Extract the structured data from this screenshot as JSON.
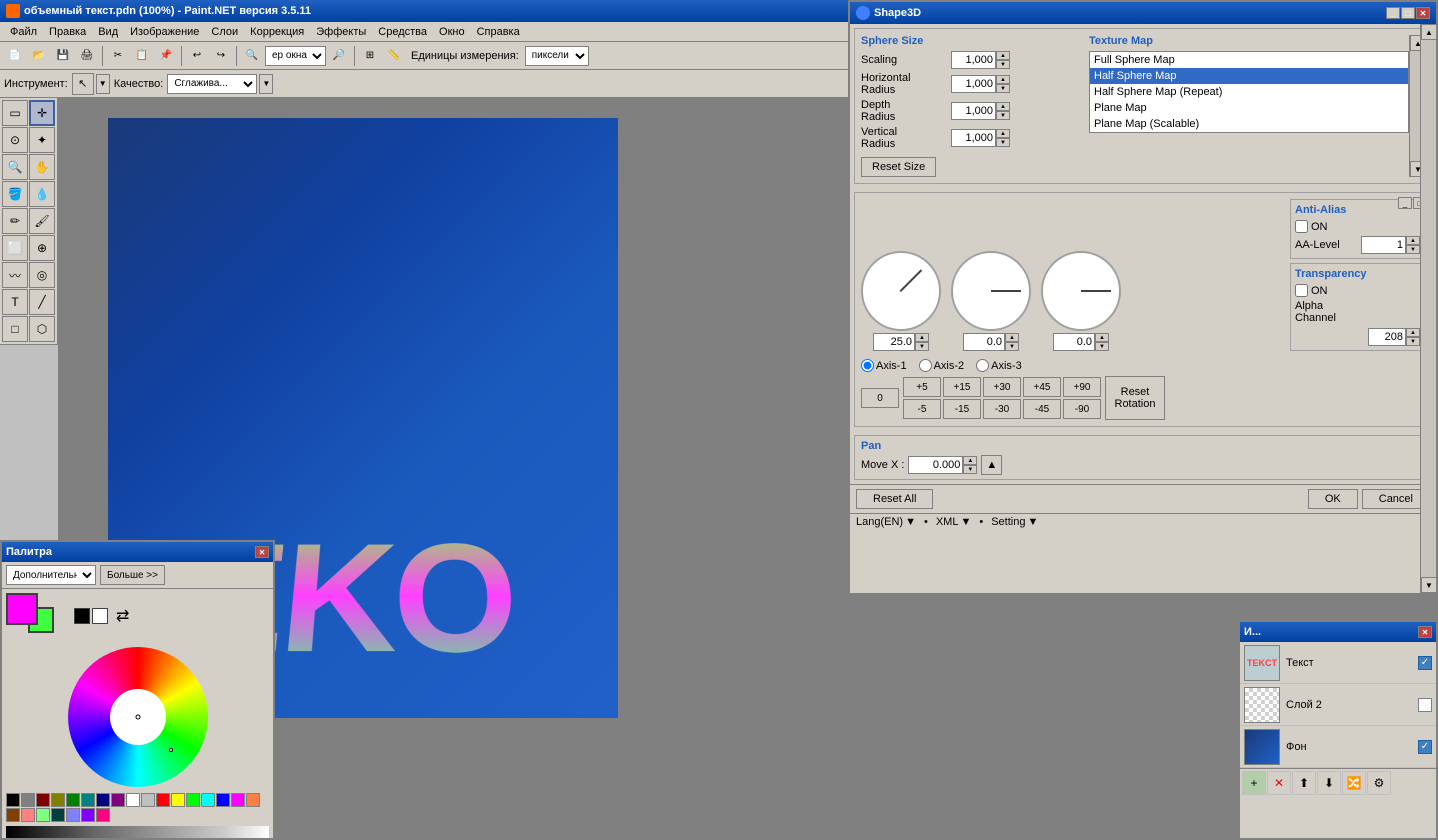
{
  "app": {
    "title": "объемный текст.pdn (100%) - Paint.NET версия 3.5.11",
    "icon": "paint-icon"
  },
  "menu": {
    "items": [
      "Файл",
      "Правка",
      "Вид",
      "Изображение",
      "Слои",
      "Коррекция",
      "Эффекты",
      "Средства",
      "Окно",
      "Справка"
    ]
  },
  "toolbar": {
    "zoom_combo": "ер окна",
    "units_label": "Единицы измерения:",
    "units_value": "пиксели"
  },
  "tool_options": {
    "tool_label": "Инструмент:",
    "tool_value": "...",
    "quality_label": "Качество:",
    "quality_value": "Сглажива..."
  },
  "shape3d": {
    "title": "Shape3D",
    "sphere_size_title": "Sphere Size",
    "scaling_label": "Scaling",
    "scaling_value": "1,000",
    "horizontal_radius_label": "Horizontal Radius",
    "horizontal_value": "1,000",
    "depth_radius_label": "Depth Radius",
    "depth_value": "1,000",
    "vertical_radius_label": "Vertical Radius",
    "vertical_value": "1,000",
    "reset_size_btn": "Reset Size",
    "texture_map_title": "Texture Map",
    "texture_items": [
      {
        "label": "Full Sphere Map",
        "selected": false
      },
      {
        "label": "Half Sphere Map",
        "selected": true
      },
      {
        "label": "Half Sphere Map (Repeat)",
        "selected": false
      },
      {
        "label": "Plane Map",
        "selected": false
      },
      {
        "label": "Plane Map (Scalable)",
        "selected": false
      }
    ],
    "rotation_section": {
      "axis1_label": "Axis-1",
      "axis2_label": "Axis-2",
      "axis3_label": "Axis-3",
      "axis1_value": "25.0",
      "axis2_value": "0.0",
      "axis3_value": "0.0",
      "zero_btn": "0",
      "angle_btns_pos": [
        "+5",
        "+15",
        "+30",
        "+45",
        "+90"
      ],
      "angle_btns_neg": [
        "-5",
        "-15",
        "-30",
        "-45",
        "-90"
      ],
      "reset_rotation_btn": "Reset Rotation"
    },
    "anti_alias": {
      "title": "Anti-Alias",
      "on_label": "ON",
      "aa_level_label": "AA-Level",
      "aa_level_value": "1"
    },
    "transparency": {
      "title": "Transparency",
      "on_label": "ON",
      "alpha_channel_label": "Alpha Channel",
      "alpha_value": "208"
    },
    "pan": {
      "title": "Pan",
      "move_x_label": "Move X :",
      "move_x_value": "0.000"
    },
    "buttons": {
      "reset_all": "Reset All",
      "ok": "OK",
      "cancel": "Cancel"
    },
    "lang_bar": {
      "lang": "Lang(EN)",
      "xml": "XML",
      "setting": "Setting"
    }
  },
  "layers": {
    "title": "И...",
    "items": [
      {
        "name": "Текст",
        "checked": true,
        "type": "text"
      },
      {
        "name": "Слой 2",
        "checked": false,
        "type": "empty"
      },
      {
        "name": "Фон",
        "checked": true,
        "type": "blue"
      }
    ],
    "toolbar_btns": [
      "➕",
      "✖",
      "⬆",
      "⬇",
      "🔀"
    ]
  },
  "palette": {
    "title": "Палитра",
    "mode_value": "Дополнительны",
    "more_btn": "Больше >>",
    "primary_color": "#ff00ff",
    "secondary_color": "#40ff40",
    "palette_colors": [
      "#000000",
      "#808080",
      "#800000",
      "#808000",
      "#008000",
      "#008080",
      "#000080",
      "#800080",
      "#ffffff",
      "#c0c0c0",
      "#ff0000",
      "#ffff00",
      "#00ff00",
      "#00ffff",
      "#0000ff",
      "#ff00ff",
      "#ff8040",
      "#804000",
      "#804040",
      "#408040",
      "#004040",
      "#4040ff",
      "#8000ff",
      "#ff0080"
    ]
  },
  "canvas": {
    "text": "ТEKO"
  }
}
